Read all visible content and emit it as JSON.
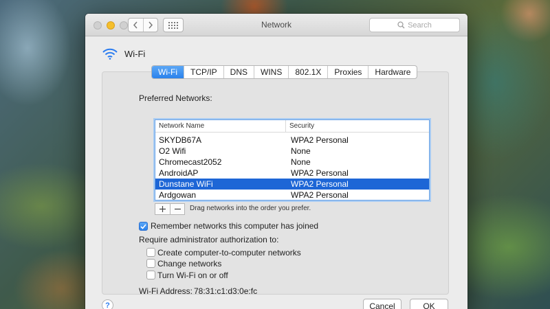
{
  "window": {
    "title": "Network"
  },
  "toolbar": {
    "search_placeholder": "Search",
    "back_icon": "chevron-left-icon",
    "forward_icon": "chevron-right-icon",
    "grid_icon": "grid-icon"
  },
  "header": {
    "label": "Wi-Fi",
    "icon": "wifi-icon"
  },
  "tabs": [
    {
      "label": "Wi-Fi",
      "active": true
    },
    {
      "label": "TCP/IP",
      "active": false
    },
    {
      "label": "DNS",
      "active": false
    },
    {
      "label": "WINS",
      "active": false
    },
    {
      "label": "802.1X",
      "active": false
    },
    {
      "label": "Proxies",
      "active": false
    },
    {
      "label": "Hardware",
      "active": false
    }
  ],
  "preferred": {
    "label": "Preferred Networks:",
    "columns": [
      "Network Name",
      "Security"
    ],
    "rows": [
      {
        "name": "SKYDB67A",
        "security": "WPA2 Personal",
        "selected": false
      },
      {
        "name": "O2 Wifi",
        "security": "None",
        "selected": false
      },
      {
        "name": "Chromecast2052",
        "security": "None",
        "selected": false
      },
      {
        "name": "AndroidAP",
        "security": "WPA2 Personal",
        "selected": false
      },
      {
        "name": "Dunstane WiFi",
        "security": "WPA2 Personal",
        "selected": true
      },
      {
        "name": "Ardgowan",
        "security": "WPA2 Personal",
        "selected": false
      }
    ],
    "add_label": "+",
    "remove_label": "—",
    "hint": "Drag networks into the order you prefer."
  },
  "options": {
    "remember": {
      "label": "Remember networks this computer has joined",
      "checked": true
    },
    "require_label": "Require administrator authorization to:",
    "admin": [
      {
        "label": "Create computer-to-computer networks",
        "checked": false
      },
      {
        "label": "Change networks",
        "checked": false
      },
      {
        "label": "Turn Wi-Fi on or off",
        "checked": false
      }
    ]
  },
  "address": {
    "label": "Wi-Fi Address:",
    "value": "78:31:c1:d3:0e:fc"
  },
  "footer": {
    "help_label": "?",
    "cancel_label": "Cancel",
    "ok_label": "OK"
  }
}
